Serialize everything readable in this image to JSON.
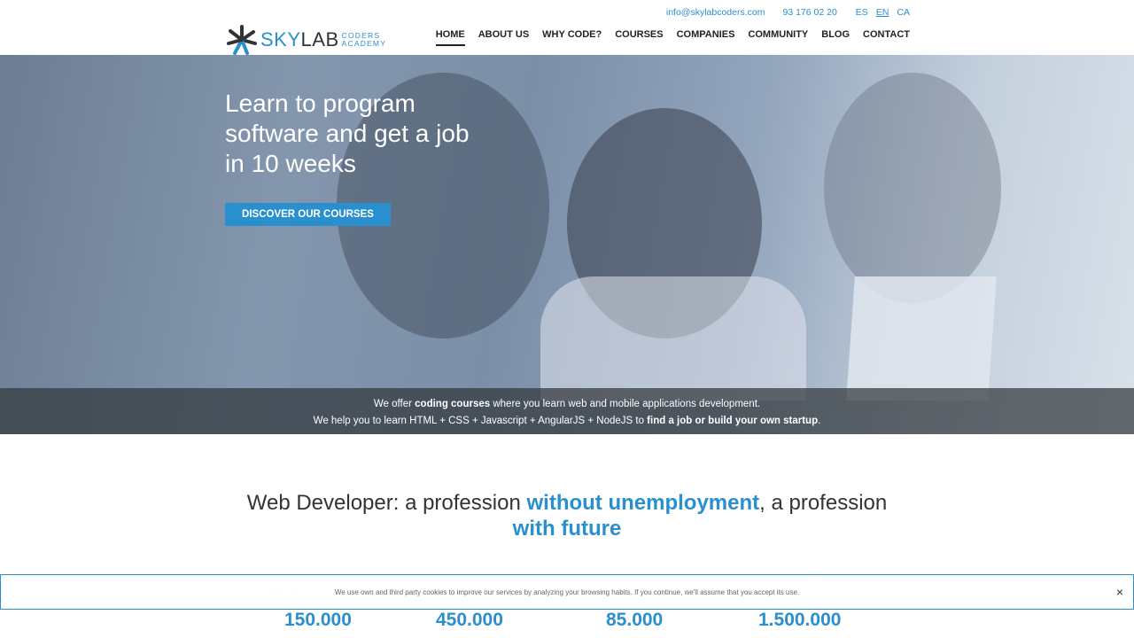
{
  "header": {
    "email": "info@skylabcoders.com",
    "phone": "93 176 02 20",
    "languages": [
      {
        "code": "ES",
        "active": false
      },
      {
        "code": "EN",
        "active": true
      },
      {
        "code": "CA",
        "active": false
      }
    ],
    "logo": {
      "sky": "SKY",
      "lab": "LAB",
      "sub1": "CODERS",
      "sub2": "ACADEMY"
    },
    "nav": [
      "HOME",
      "ABOUT US",
      "WHY CODE?",
      "COURSES",
      "COMPANIES",
      "COMMUNITY",
      "BLOG",
      "CONTACT"
    ]
  },
  "hero": {
    "title": "Learn to program software and get a job in 10 weeks",
    "cta": "DISCOVER OUR COURSES",
    "line1_prefix": "We offer ",
    "line1_bold": "coding courses",
    "line1_suffix": " where you learn web and mobile applications development.",
    "line2_prefix": "We help you to learn HTML + CSS + Javascript + AngularJS + NodeJS to ",
    "line2_bold": "find a job or build your own startup",
    "line2_suffix": "."
  },
  "section": {
    "h1": "Web Developer: a profession ",
    "h2": "without unemployment",
    "h3": ", a profession",
    "h4": "with future"
  },
  "stats": [
    "150.000",
    "450.000",
    "85.000",
    "1.500.000"
  ],
  "cookie": {
    "text": "We use own and third party cookies to improve our services by analyzing your browsing habits. If you continue, we'll assume that you accept its use.",
    "close": "×"
  },
  "colors": {
    "accent": "#2a8fcf"
  }
}
